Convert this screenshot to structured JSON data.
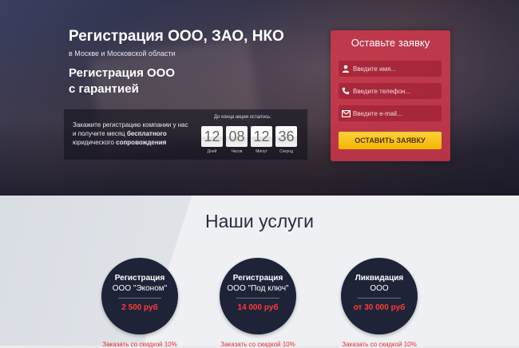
{
  "hero": {
    "title": "Регистрация ООО, ЗАО, НКО",
    "subtitle": "в Москве и Московской области",
    "title2_line1": "Регистрация ООО",
    "title2_line2": "с гарантией",
    "promo_text_part1": "Закажите регистрацию компании у нас и получите месяц ",
    "promo_text_bold1": "бесплатного",
    "promo_text_part2": " юридического ",
    "promo_text_bold2": "сопровождения",
    "countdown_label": "До конца акции осталось:",
    "timer": [
      {
        "value": "12",
        "unit": "Дней"
      },
      {
        "value": "08",
        "unit": "Часов"
      },
      {
        "value": "12",
        "unit": "Минут"
      },
      {
        "value": "36",
        "unit": "Секунд"
      }
    ]
  },
  "form": {
    "title": "Оставьте заявку",
    "name_placeholder": "Введите имя...",
    "phone_placeholder": "Введите телефон...",
    "email_placeholder": "Введите e-mail...",
    "submit_label": "ОСТАВИТЬ ЗАЯВКУ"
  },
  "services": {
    "title": "Наши услуги",
    "items": [
      {
        "line1": "Регистрация",
        "line2": "ООО \"Эконом\"",
        "price": "2 500 руб",
        "link": "Заказать со скидкой 10%"
      },
      {
        "line1": "Регистрация",
        "line2": "ООО \"Под ключ\"",
        "price": "14 000 руб",
        "link": "Заказать со скидкой 10%"
      },
      {
        "line1": "Ликвидация",
        "line2": "ООО",
        "price": "от 30 000 руб",
        "link": "Заказать со скидкой 10%"
      }
    ]
  },
  "colors": {
    "accent_red": "#d7374b",
    "button_yellow": "#f4b400",
    "price_red": "#ff3a3a",
    "dark_navy": "#1f2338"
  }
}
